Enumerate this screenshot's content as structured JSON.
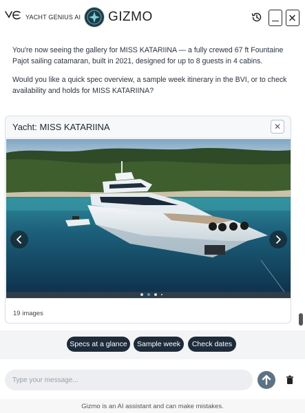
{
  "header": {
    "brand_name": "YACHT GENIUS AI",
    "assistant_name": "GIZMO"
  },
  "messages": [
    "You're now seeing the gallery for MISS KATARIINA — a fully crewed 67 ft Fountaine Pajot sailing catamaran, built in 2021, designed for up to 8 guests in 4 cabins.",
    "Would you like a quick spec overview, a sample week itinerary in the BVI, or to check availability and holds for MISS KATARIINA?"
  ],
  "gallery": {
    "title": "Yacht: MISS KATARIINA",
    "close_glyph": "✕",
    "image_count_label": "19 images",
    "active_image_index": 1,
    "dot_count": 4
  },
  "suggestions": [
    "Specs at a glance",
    "Sample week",
    "Check dates"
  ],
  "composer": {
    "placeholder": "Type your message...",
    "value": ""
  },
  "disclaimer": "Gizmo is an AI assistant and can make mistakes.",
  "icons": {
    "history": "history-icon",
    "minimize": "minimize-icon",
    "close": "close-icon",
    "prev": "chevron-left-icon",
    "next": "chevron-right-icon",
    "send": "arrow-up-icon",
    "trash": "trash-icon"
  },
  "colors": {
    "chip_bg": "#1e2b3a",
    "send_bg": "#5c7385",
    "dot_active": "#3aa2e6",
    "logo_bg": "#1f3b47"
  }
}
